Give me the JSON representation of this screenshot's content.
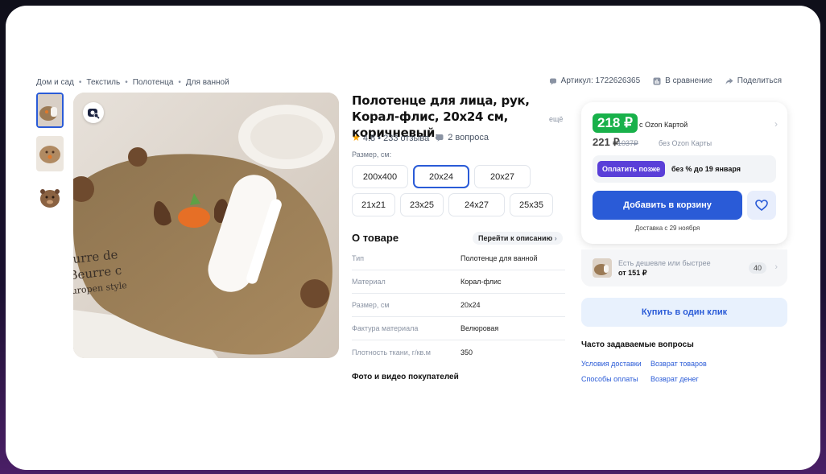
{
  "breadcrumb": [
    "Дом и сад",
    "Текстиль",
    "Полотенца",
    "Для ванной"
  ],
  "breadcrumb_sep": "•",
  "top_actions": {
    "article": "Артикул: 1722626365",
    "compare": "В сравнение",
    "share": "Поделиться"
  },
  "product": {
    "title": "Полотенце для лица, рук, Корал-флис, 20x24 см, коричневый,",
    "more": "ещё",
    "rating": "4.8 • 233 отзыва",
    "questions": "2 вопроса",
    "size_label": "Размер, см:",
    "sizes": [
      "200x400",
      "20x24",
      "20x27",
      "21x21",
      "23x25",
      "24x27",
      "25x35"
    ],
    "selected_size": "20x24",
    "image_watermark_lines": [
      "urre de",
      "Beurre c",
      "uropen style"
    ]
  },
  "about": {
    "heading": "О товаре",
    "link": "Перейти к описанию",
    "specs": [
      {
        "k": "Тип",
        "v": "Полотенце для ванной"
      },
      {
        "k": "Материал",
        "v": "Корал-флис"
      },
      {
        "k": "Размер, см",
        "v": "20x24"
      },
      {
        "k": "Фактура материала",
        "v": "Велюровая"
      },
      {
        "k": "Плотность ткани, г/кв.м",
        "v": "350"
      }
    ],
    "photos_heading": "Фото и видео покупателей"
  },
  "price": {
    "card_price": "218 ₽",
    "card_label": "с Ozon Картой",
    "regular_price": "221 ₽",
    "old_price": "1037₽",
    "no_card": "без Ozon Карты",
    "later_button": "Оплатить позже",
    "later_text": "без % до 19 января",
    "cart_button": "Добавить в корзину",
    "delivery": "Доставка с 29 ноября"
  },
  "cheaper": {
    "line1": "Есть дешевле или быстрее",
    "line2": "от 151 ₽",
    "count": "40"
  },
  "one_click": "Купить в один клик",
  "faq": {
    "heading": "Часто задаваемые вопросы",
    "links": [
      "Условия доставки",
      "Возврат товаров",
      "Способы оплаты",
      "Возврат денег"
    ]
  },
  "colors": {
    "accent": "#2a5bd7",
    "price_green": "#18b14a",
    "later_purple": "#5a3fd8"
  }
}
